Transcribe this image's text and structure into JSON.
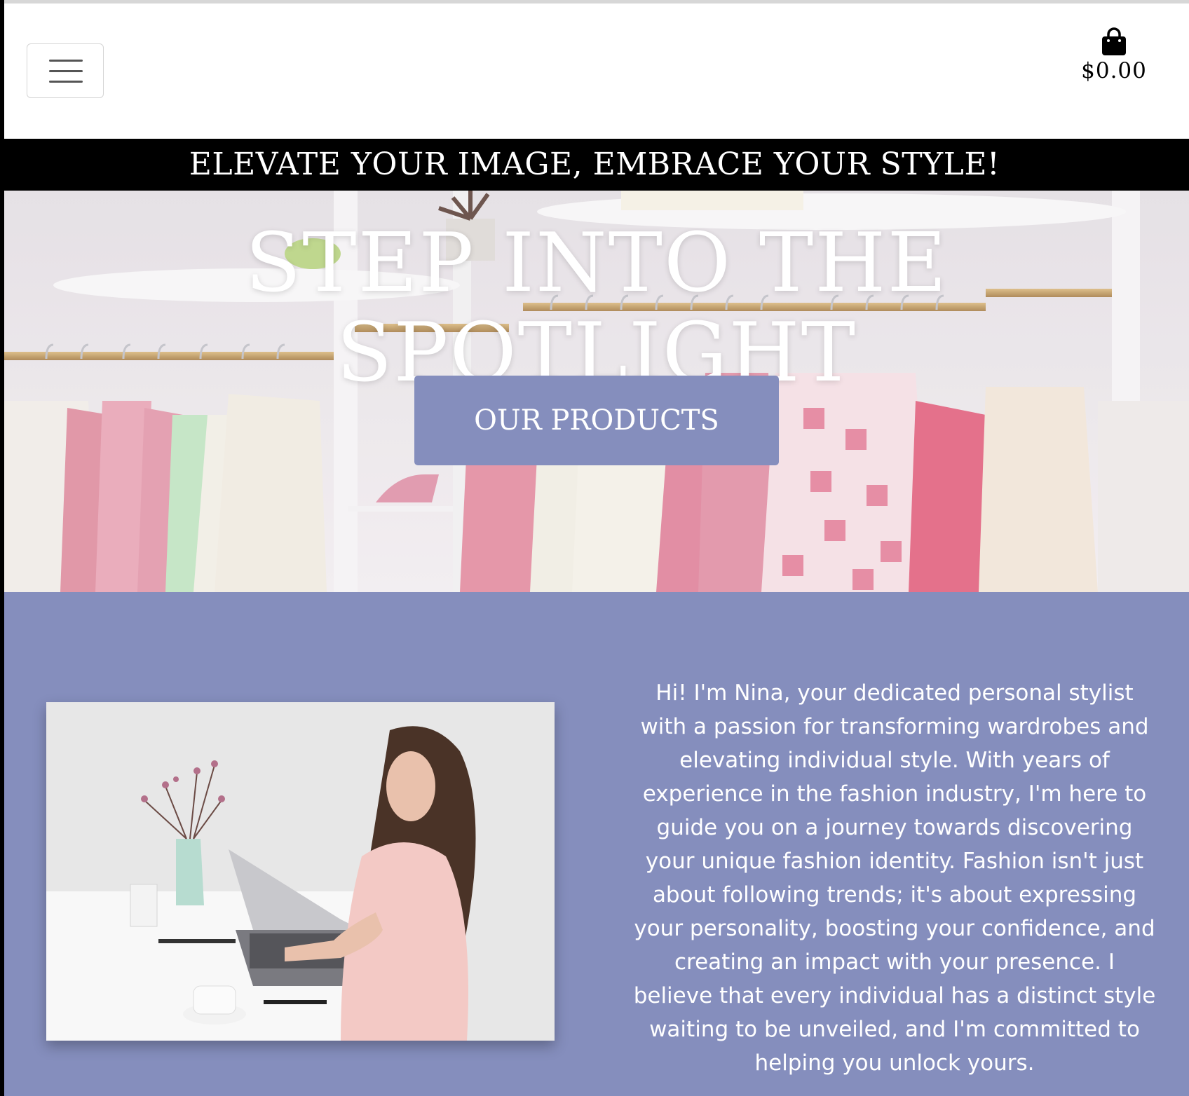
{
  "header": {
    "menu_icon": "hamburger-menu-icon",
    "cart_icon": "shopping-bag-icon",
    "cart_total": "$0.00"
  },
  "promo": {
    "text": "ELEVATE YOUR IMAGE, EMBRACE YOUR STYLE!"
  },
  "hero": {
    "title": "STEP INTO THE SPOTLIGHT",
    "button_label": "OUR PRODUCTS"
  },
  "about": {
    "paragraph": "Hi! I'm Nina, your dedicated personal stylist with a passion for transforming wardrobes and elevating individual style. With years of experience in the fashion industry, I'm here to guide you on a journey towards discovering your unique fashion identity. Fashion isn't just about following trends; it's about expressing your personality, boosting your confidence, and creating an impact with your presence. I believe that every individual has a distinct style waiting to be unveiled, and I'm committed to helping you unlock yours."
  },
  "colors": {
    "accent": "#858ebd",
    "promo_bg": "#000000",
    "text_light": "#ffffff"
  }
}
